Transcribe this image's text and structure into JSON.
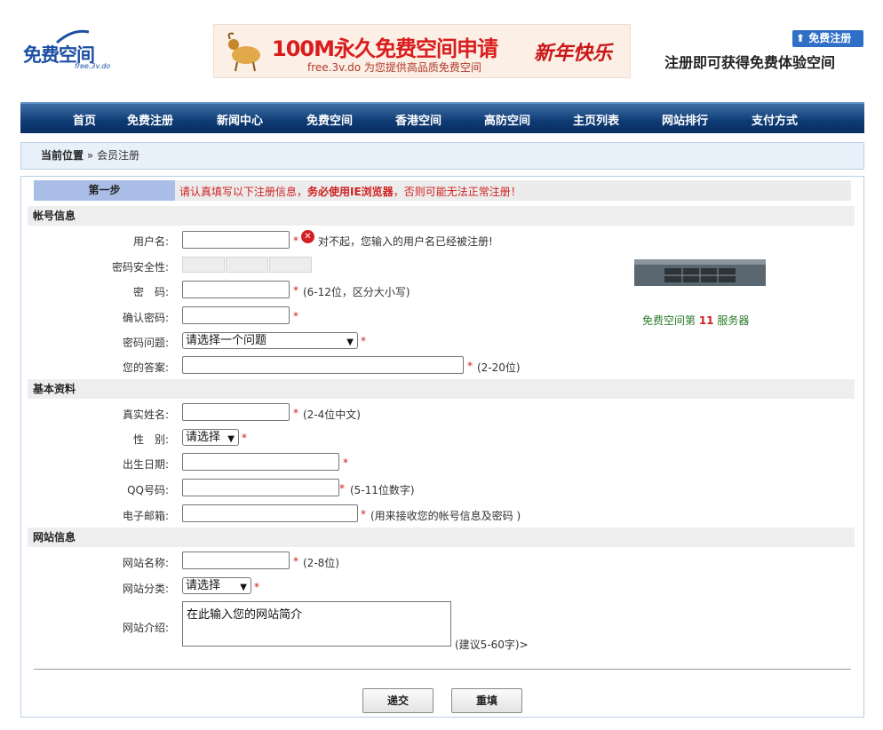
{
  "header": {
    "logo_text": "免费空间",
    "logo_sub": "free.3v.do",
    "banner_title": "100M永久免费空间申请",
    "banner_sub": "free.3v.do 为您提供高品质免费空间",
    "banner_newyear": "新年快乐",
    "register_badge": "免费注册",
    "slogan": "注册即可获得免费体验空间"
  },
  "nav": [
    "首页",
    "免费注册",
    "新闻中心",
    "免费空间",
    "香港空间",
    "高防空间",
    "主页列表",
    "网站排行",
    "支付方式"
  ],
  "breadcrumb": {
    "label": "当前位置",
    "sep": " » ",
    "page": "会员注册"
  },
  "step": {
    "label": "第一步",
    "note_a": "请认真填写以下注册信息，",
    "note_b": "务必使用IE浏览器",
    "note_c": "，否则可能无法正常注册！"
  },
  "sections": {
    "account": "帐号信息",
    "basic": "基本资料",
    "site": "网站信息"
  },
  "fields": {
    "username": {
      "label": "用户名:",
      "value": "",
      "error": "对不起，您输入的用户名已经被注册!"
    },
    "strength": {
      "label": "密码安全性:"
    },
    "password": {
      "label": "密　码:",
      "hint": "(6-12位，区分大小写)"
    },
    "confirm": {
      "label": "确认密码:"
    },
    "question": {
      "label": "密码问题:",
      "selected": "请选择一个问题"
    },
    "answer": {
      "label": "您的答案:",
      "hint": "(2-20位)"
    },
    "realname": {
      "label": "真实姓名:",
      "hint": "(2-4位中文)"
    },
    "gender": {
      "label": "性　别:",
      "selected": "请选择"
    },
    "birth": {
      "label": "出生日期:"
    },
    "qq": {
      "label": "QQ号码:",
      "hint": "(5-11位数字)"
    },
    "email": {
      "label": "电子邮箱:",
      "hint": "(用来接收您的帐号信息及密码 )"
    },
    "sitename": {
      "label": "网站名称:",
      "hint": "(2-8位)"
    },
    "category": {
      "label": "网站分类:",
      "selected": "请选择"
    },
    "intro": {
      "label": "网站介绍:",
      "value": "在此输入您的网站简介",
      "hint": "(建议5-60字)>"
    }
  },
  "star": "*",
  "server": {
    "caption_a": "免费空间第 ",
    "number": "11",
    "caption_b": " 服务器"
  },
  "buttons": {
    "submit": "递交",
    "reset": "重填"
  },
  "icons": {
    "error": "error-circle-icon",
    "chevron": "chevron-down-icon",
    "arrow": "arrow-up-icon"
  }
}
